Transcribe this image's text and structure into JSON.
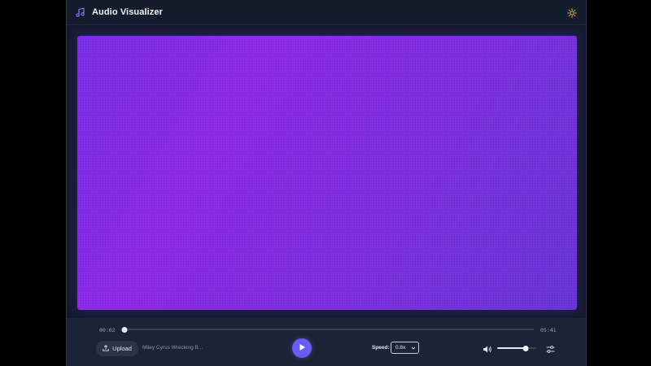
{
  "app": {
    "title": "Audio Visualizer"
  },
  "colors": {
    "accent": "#6a5cf0",
    "icon_accent": "#8a7cf8",
    "sun": "#f5c84b",
    "canvas_start": "#7b2fe6",
    "canvas_end": "#6a36d9"
  },
  "icons": {
    "title_icon": "music-note-icon",
    "theme_toggle": "sun-icon",
    "upload": "upload-icon",
    "play": "play-icon",
    "volume": "volume-icon",
    "settings": "sliders-icon"
  },
  "player": {
    "current_time": "00:02",
    "total_time": "05:41",
    "progress": 0.005,
    "volume": 0.72
  },
  "controls": {
    "upload_label": "Upload",
    "track_name": "Miley Cyrus Wrecking B...",
    "speed_label": "Speed:",
    "speed_value": "0.8x"
  }
}
